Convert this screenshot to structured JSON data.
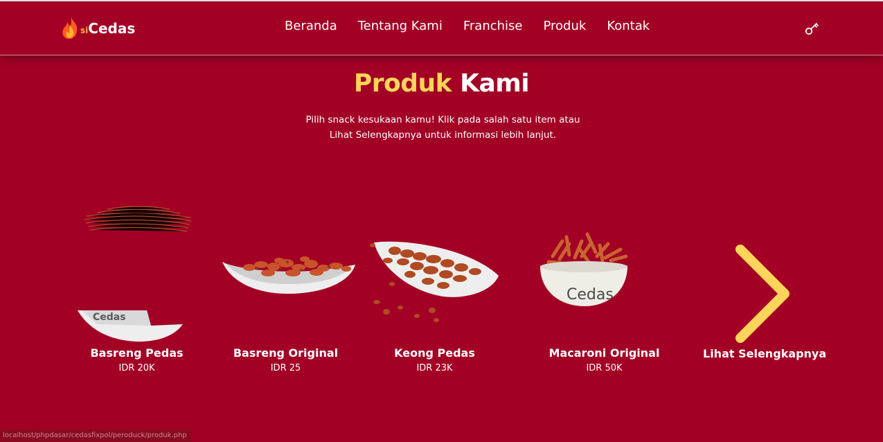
{
  "brand": {
    "prefix": "si",
    "name": "Cedas",
    "flame_colors": [
      "#ff5a1f",
      "#ffb22e"
    ]
  },
  "nav": {
    "items": [
      {
        "label": "Beranda"
      },
      {
        "label": "Tentang Kami"
      },
      {
        "label": "Franchise"
      },
      {
        "label": "Produk"
      },
      {
        "label": "Kontak"
      }
    ],
    "login_icon": "key-icon"
  },
  "section": {
    "title_accent": "Produk",
    "title_rest": "Kami",
    "subtitle_line1": "Pilih snack kesukaan kamu! Klik pada salah satu item atau",
    "subtitle_line2": "Lihat Selengkapnya untuk informasi lebih lanjut."
  },
  "products": [
    {
      "name": "Basreng Pedas",
      "price": "IDR 20K",
      "bowl_text": "Cedas"
    },
    {
      "name": "Basreng Original",
      "price": "IDR 25"
    },
    {
      "name": "Keong Pedas",
      "price": "IDR 23K"
    },
    {
      "name": "Macaroni Original",
      "price": "IDR 50K",
      "bowl_text": "Cedas"
    }
  ],
  "more": {
    "label": "Lihat Selengkapnya",
    "icon": "chevron-right-icon"
  },
  "status_url": "localhost/phpdasar/cedasfixpol/peroduck/produk.php",
  "colors": {
    "background": "#a30025",
    "accent_yellow": "#ffd45a",
    "snack": "#c9532a",
    "plate": "#eeeeee"
  }
}
